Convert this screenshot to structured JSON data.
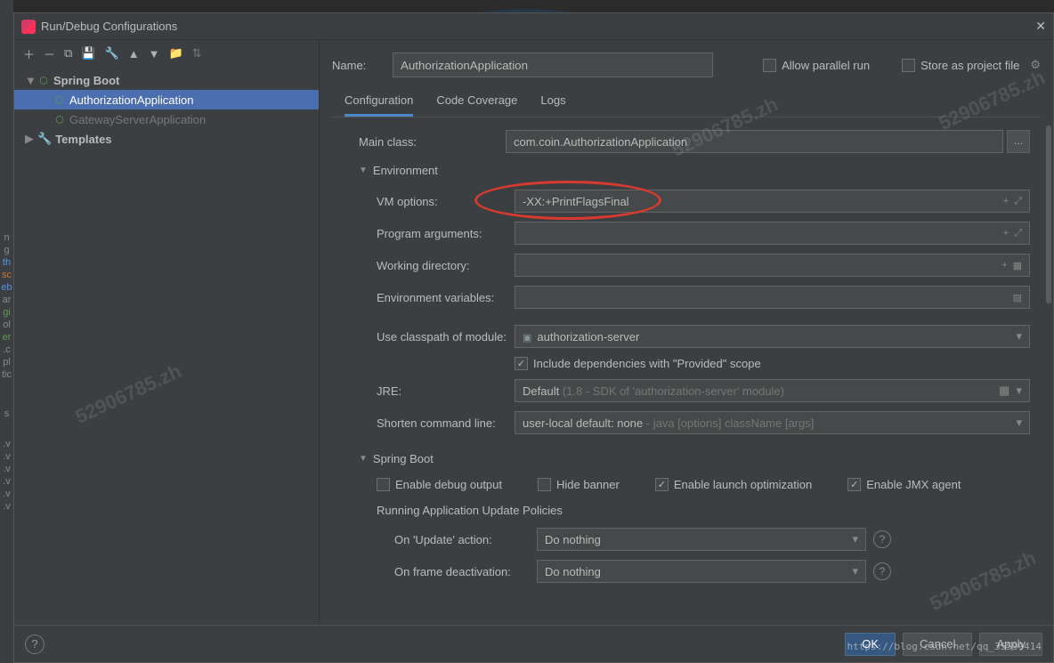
{
  "window": {
    "title": "Run/Debug Configurations"
  },
  "tree": {
    "nodes": [
      {
        "label": "Spring Boot",
        "expanded": true
      },
      {
        "label": "AuthorizationApplication",
        "selected": true
      },
      {
        "label": "GatewayServerApplication"
      },
      {
        "label": "Templates"
      }
    ]
  },
  "form": {
    "name_label": "Name:",
    "name_value": "AuthorizationApplication",
    "allow_parallel": "Allow parallel run",
    "store_project": "Store as project file",
    "tabs": [
      "Configuration",
      "Code Coverage",
      "Logs"
    ],
    "main_class_label": "Main class:",
    "main_class_value": "com.coin.AuthorizationApplication",
    "env_section": "Environment",
    "vm_options_label": "VM options:",
    "vm_options_value": "-XX:+PrintFlagsFinal",
    "prog_args_label": "Program arguments:",
    "working_dir_label": "Working directory:",
    "env_vars_label": "Environment variables:",
    "classpath_label": "Use classpath of module:",
    "classpath_value": "authorization-server",
    "include_deps": "Include dependencies with \"Provided\" scope",
    "jre_label": "JRE:",
    "jre_value": "Default",
    "jre_hint": "(1.8 - SDK of 'authorization-server' module)",
    "shorten_label": "Shorten command line:",
    "shorten_value": "user-local default: none",
    "shorten_hint": "- java [options] className [args]",
    "spring_section": "Spring Boot",
    "enable_debug": "Enable debug output",
    "hide_banner": "Hide banner",
    "enable_launch": "Enable launch optimization",
    "enable_jmx": "Enable JMX agent",
    "update_policies": "Running Application Update Policies",
    "on_update_label": "On 'Update' action:",
    "on_update_value": "Do nothing",
    "on_frame_label": "On frame deactivation:",
    "on_frame_value": "Do nothing"
  },
  "buttons": {
    "ok": "OK",
    "cancel": "Cancel",
    "apply": "Apply"
  },
  "watermark": "52906785.zh",
  "url_watermark": "https://blog.csdn.net/qq_35599414"
}
